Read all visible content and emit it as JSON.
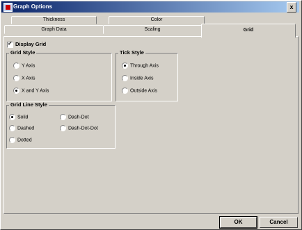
{
  "window": {
    "title": "Graph Options",
    "close_label": "x"
  },
  "tabs_back": [
    {
      "label": "Thickness"
    },
    {
      "label": "Color"
    }
  ],
  "tabs_front": [
    {
      "label": "Graph Data"
    },
    {
      "label": "Scaling"
    },
    {
      "label": "Grid"
    }
  ],
  "active_tab": "Grid",
  "display_grid": {
    "label": "Display Grid",
    "checked": true
  },
  "grid_style": {
    "title": "Grid Style",
    "options": [
      {
        "label": "Y Axis"
      },
      {
        "label": "X Axis"
      },
      {
        "label": "X and Y Axis"
      }
    ],
    "selected": "X and Y Axis"
  },
  "tick_style": {
    "title": "Tick Style",
    "options": [
      {
        "label": "Through Axis"
      },
      {
        "label": "Inside Axis"
      },
      {
        "label": "Outside Axis"
      }
    ],
    "selected": "Through Axis"
  },
  "grid_line_style": {
    "title": "Grid Line Style",
    "options": [
      {
        "label": "Solid"
      },
      {
        "label": "Dashed"
      },
      {
        "label": "Dotted"
      },
      {
        "label": "Dash-Dot"
      },
      {
        "label": "Dash-Dot-Dot"
      }
    ],
    "selected": "Solid"
  },
  "buttons": {
    "ok": "OK",
    "cancel": "Cancel"
  }
}
